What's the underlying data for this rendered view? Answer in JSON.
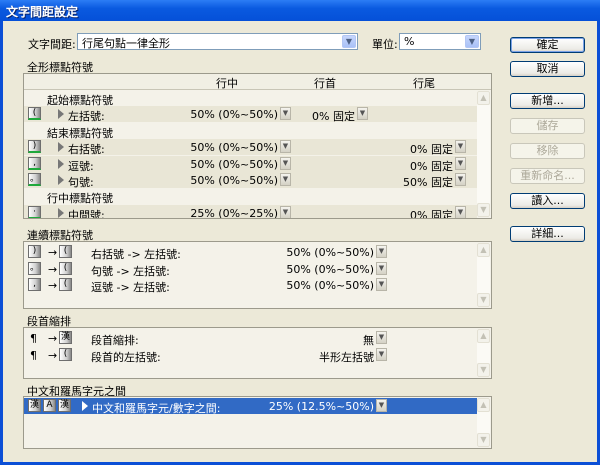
{
  "title": "文字間距設定",
  "mojikumi_label": "文字間距:",
  "mojikumi_value": "行尾句點一律全形",
  "unit_label": "單位:",
  "unit_value": "%",
  "buttons": {
    "ok": "確定",
    "cancel": "取消",
    "new": "新增...",
    "save": "儲存",
    "remove": "移除",
    "rename": "重新命名...",
    "load": "讀入...",
    "detail": "詳細..."
  },
  "fullwidth": {
    "title": "全形標點符號",
    "col_mid": "行中",
    "col_start": "行首",
    "col_end": "行尾",
    "rows": [
      {
        "type": "group",
        "label": "起始標點符號"
      },
      {
        "type": "item",
        "icon": "(",
        "label": "左括號:",
        "mid": "50% (0%~50%)",
        "start": "0% 固定",
        "end": ""
      },
      {
        "type": "group",
        "label": "結束標點符號"
      },
      {
        "type": "item",
        "icon": ")",
        "label": "右括號:",
        "mid": "50% (0%~50%)",
        "start": "",
        "end": "0% 固定"
      },
      {
        "type": "item",
        "icon": ",",
        "label": "逗號:",
        "mid": "50% (0%~50%)",
        "start": "",
        "end": "0% 固定"
      },
      {
        "type": "item",
        "icon": "。",
        "label": "句號:",
        "mid": "50% (0%~50%)",
        "start": "",
        "end": "50% 固定"
      },
      {
        "type": "group",
        "label": "行中標點符號"
      },
      {
        "type": "item",
        "icon": "·",
        "label": "中間號:",
        "mid": "25% (0%~25%)",
        "start": "",
        "end": "0% 固定"
      }
    ]
  },
  "adjacent": {
    "title": "連續標點符號",
    "rows": [
      {
        "a": ")",
        "b": "(",
        "label": "右括號 -> 左括號:",
        "value": "50% (0%~50%)"
      },
      {
        "a": "。",
        "b": "(",
        "label": "句號 -> 左括號:",
        "value": "50% (0%~50%)"
      },
      {
        "a": ",",
        "b": "(",
        "label": "逗號 -> 左括號:",
        "value": "50% (0%~50%)"
      }
    ]
  },
  "indent": {
    "title": "段首縮排",
    "rows": [
      {
        "a": "¶",
        "b": "漢",
        "label": "段首縮排:",
        "value": "無"
      },
      {
        "a": "¶",
        "b": "(",
        "label": "段首的左括號:",
        "value": "半形左括號"
      }
    ]
  },
  "roman": {
    "title": "中文和羅馬字元之間",
    "rows": [
      {
        "icons": [
          "漢",
          "A",
          "漢"
        ],
        "label": "中文和羅馬字元/數字之間:",
        "value": "25% (12.5%~50%)"
      }
    ]
  }
}
